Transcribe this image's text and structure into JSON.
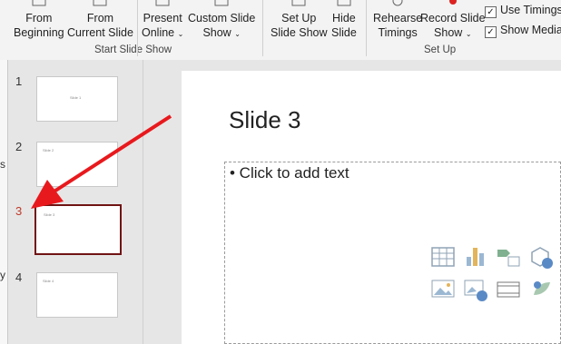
{
  "ribbon": {
    "from_beginning": [
      "From",
      "Beginning"
    ],
    "from_current": [
      "From",
      "Current Slide"
    ],
    "present_online": [
      "Present",
      "Online"
    ],
    "custom_slide_show": [
      "Custom Slide",
      "Show"
    ],
    "group_start": "Start Slide Show",
    "setup_slide_show": [
      "Set Up",
      "Slide Show"
    ],
    "hide_slide": [
      "Hide",
      "Slide"
    ],
    "rehearse": [
      "Rehearse",
      "Timings"
    ],
    "record": [
      "Record Slide",
      "Show"
    ],
    "group_setup": "Set Up",
    "use_timings": "Use Timings",
    "show_media": "Show Media",
    "caret": "⌄"
  },
  "left_edge_chars": [
    "s",
    "y"
  ],
  "slides": [
    {
      "num": "1",
      "thumb_title": "Slide 1"
    },
    {
      "num": "2",
      "thumb_title": "Slide 2"
    },
    {
      "num": "3",
      "thumb_title": "Slide 3"
    },
    {
      "num": "4",
      "thumb_title": "Slide 4"
    }
  ],
  "selected_slide_index": 2,
  "main_slide": {
    "title": "Slide 3",
    "body_placeholder": "• Click to add text"
  },
  "colors": {
    "selected_border": "#701414",
    "selected_num": "#c0392b",
    "arrow": "#e8191d"
  }
}
